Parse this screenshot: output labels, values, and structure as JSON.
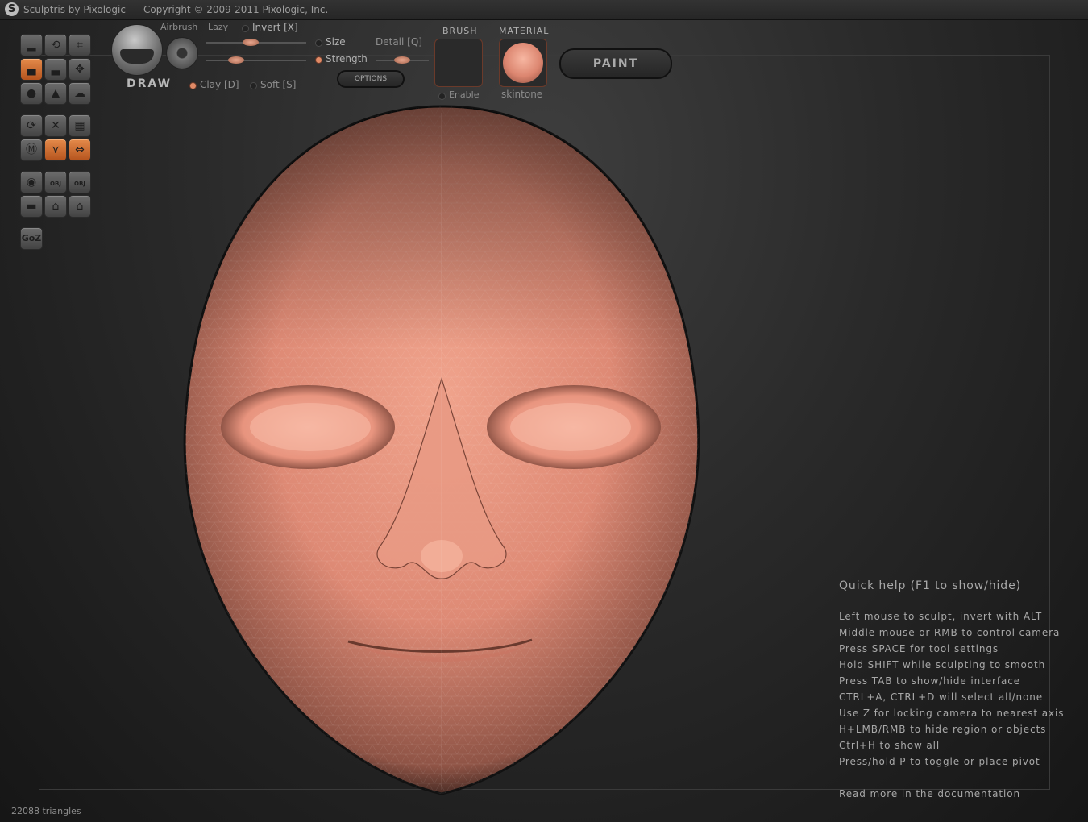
{
  "window": {
    "app_title": "Sculptris by Pixologic",
    "copyright": "Copyright © 2009-2011 Pixologic, Inc."
  },
  "brush_panel": {
    "tool_name": "DRAW",
    "airbrush": "Airbrush",
    "lazy": "Lazy",
    "invert": "Invert [X]",
    "size": "Size",
    "detail": "Detail [Q]",
    "strength": "Strength",
    "options": "OPTIONS",
    "clay": "Clay [D]",
    "soft": "Soft [S]",
    "size_value": 0.45,
    "strength_value": 0.3,
    "detail_value": 0.5
  },
  "brush": {
    "header": "BRUSH",
    "enable": "Enable"
  },
  "material": {
    "header": "MATERIAL",
    "name": "skintone",
    "color": "#e8937d"
  },
  "paint_button": "PAINT",
  "toolbar": {
    "goz": "GoZ",
    "obj": "OBJ",
    "obj2": "OBJ"
  },
  "quick_help": {
    "title": "Quick help (F1 to show/hide)",
    "lines": [
      "Left mouse to sculpt, invert with ALT",
      "Middle mouse or RMB to control camera",
      "Press SPACE for tool settings",
      "Hold SHIFT while sculpting to smooth",
      "Press TAB to show/hide interface",
      "CTRL+A, CTRL+D will select all/none",
      "Use Z for locking camera to nearest axis",
      "H+LMB/RMB to hide region or objects",
      "Ctrl+H to show all",
      "Press/hold P to toggle or place pivot"
    ],
    "docs": "Read more in the documentation"
  },
  "status": {
    "triangles": "22088 triangles"
  },
  "colors": {
    "accent": "#d9763a",
    "skin": "#e8937d"
  }
}
